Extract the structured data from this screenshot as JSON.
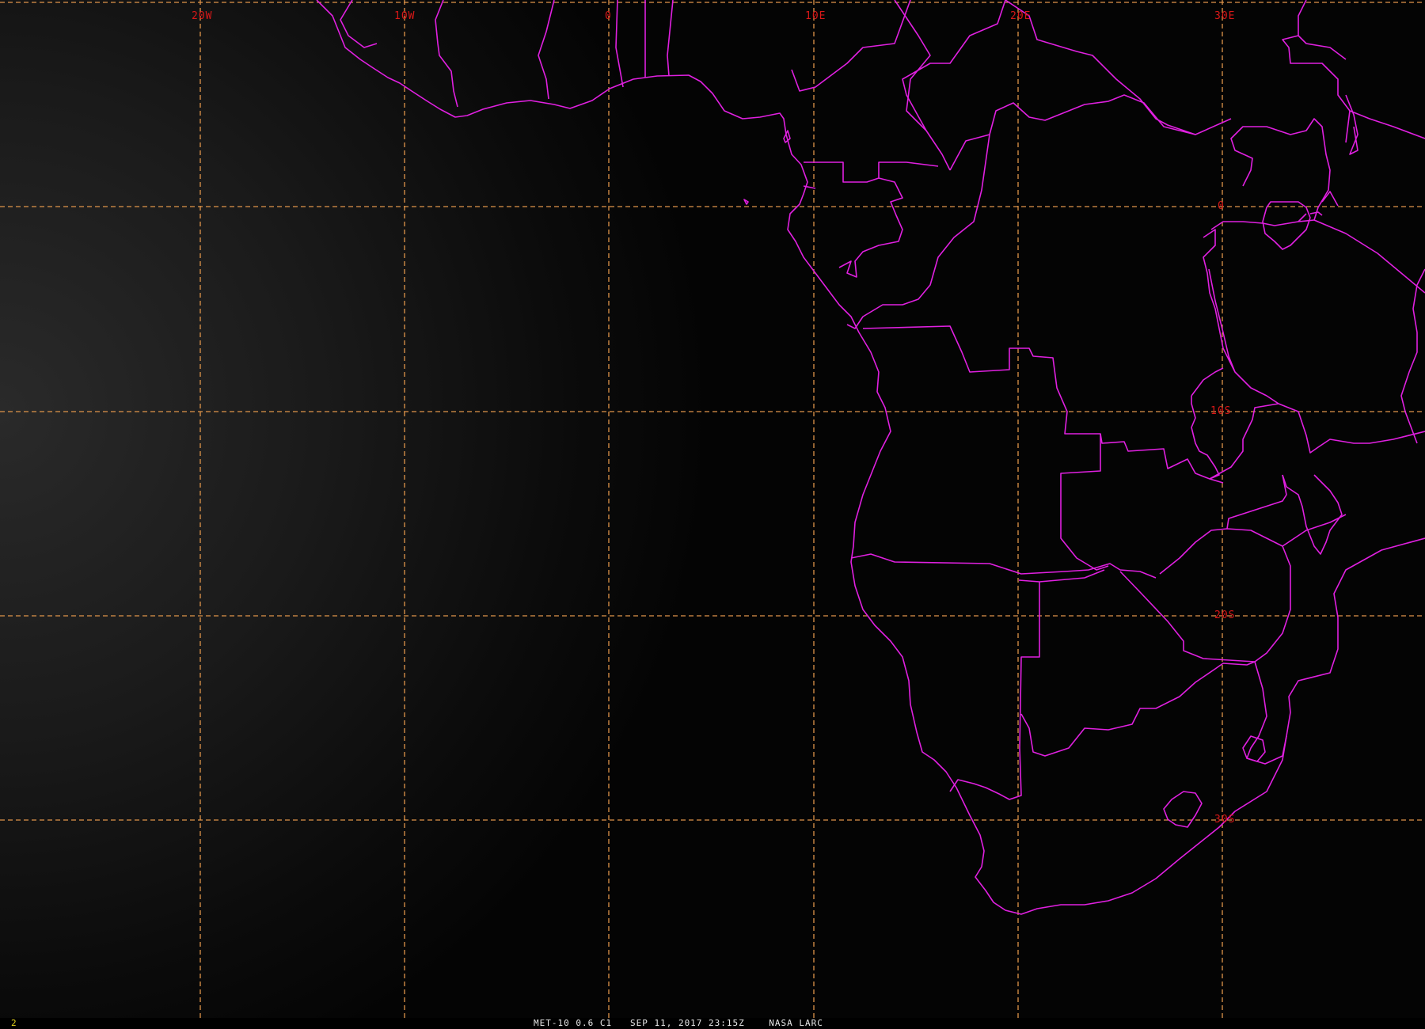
{
  "map": {
    "longitude_labels": [
      "20W",
      "10W",
      "0",
      "10E",
      "20E",
      "30E"
    ],
    "latitude_labels": [
      "0",
      "10S",
      "20S",
      "30S"
    ],
    "colors": {
      "coastline": "#e020e0",
      "graticule": "#e0954a",
      "grid_label": "#d81818"
    }
  },
  "status_bar": {
    "frame_number": "2",
    "caption": "MET-10 0.6 C1   SEP 11, 2017 23:15Z    NASA LARC"
  }
}
